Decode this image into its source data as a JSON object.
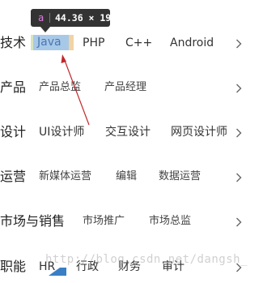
{
  "tooltip": {
    "tag": "a",
    "dimensions": "44.36 × 19"
  },
  "menu": {
    "rows": [
      {
        "category": "技术",
        "items": [
          "Java",
          "PHP",
          "C++",
          "Android"
        ]
      },
      {
        "category": "产品",
        "items": [
          "产品总监",
          "产品经理"
        ]
      },
      {
        "category": "设计",
        "items": [
          "UI设计师",
          "交互设计",
          "网页设计师"
        ]
      },
      {
        "category": "运营",
        "items": [
          "新媒体运营",
          "编辑",
          "数据运营"
        ]
      },
      {
        "category": "市场与销售",
        "items": [
          "市场推广",
          "市场总监"
        ]
      },
      {
        "category": "职能",
        "items": [
          "HR",
          "行政",
          "财务",
          "审计"
        ]
      }
    ],
    "chevron_icon": "chevron-right-icon"
  },
  "watermark": "http://blog.csdn.net/dangsh_",
  "colors": {
    "highlight_content": "#a8c8e8",
    "highlight_padding": "#f0d4a4",
    "highlight_margin": "#d8e4bc",
    "annotation_arrow": "#c0282d",
    "tooltip_bg": "#333333"
  }
}
